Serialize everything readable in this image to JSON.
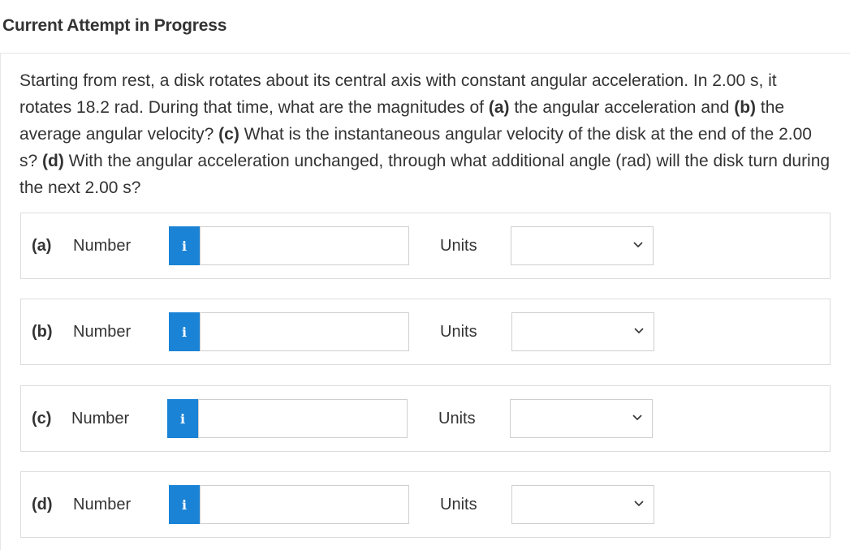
{
  "header": {
    "title": "Current Attempt in Progress"
  },
  "question": {
    "segments": [
      {
        "text": "Starting from rest, a disk rotates about its central axis with constant angular acceleration. In 2.00 s, it rotates 18.2 rad. During that time, what are the magnitudes of ",
        "bold": false
      },
      {
        "text": "(a)",
        "bold": true
      },
      {
        "text": " the angular acceleration and ",
        "bold": false
      },
      {
        "text": "(b)",
        "bold": true
      },
      {
        "text": " the average angular velocity? ",
        "bold": false
      },
      {
        "text": "(c)",
        "bold": true
      },
      {
        "text": " What is the instantaneous angular velocity of the disk at the end of the 2.00 s? ",
        "bold": false
      },
      {
        "text": "(d)",
        "bold": true
      },
      {
        "text": " With the angular acceleration unchanged, through what additional angle (rad) will the disk turn during the next 2.00 s?",
        "bold": false
      }
    ]
  },
  "answers": [
    {
      "part": "(a)",
      "number_label": "Number",
      "info_icon": "i",
      "value": "",
      "units_label": "Units",
      "units_value": ""
    },
    {
      "part": "(b)",
      "number_label": "Number",
      "info_icon": "i",
      "value": "",
      "units_label": "Units",
      "units_value": ""
    },
    {
      "part": "(c)",
      "number_label": "Number",
      "info_icon": "i",
      "value": "",
      "units_label": "Units",
      "units_value": ""
    },
    {
      "part": "(d)",
      "number_label": "Number",
      "info_icon": "i",
      "value": "",
      "units_label": "Units",
      "units_value": ""
    }
  ],
  "colors": {
    "info_button": "#1a83d6",
    "text": "#333333",
    "border": "#dcdcdc"
  }
}
